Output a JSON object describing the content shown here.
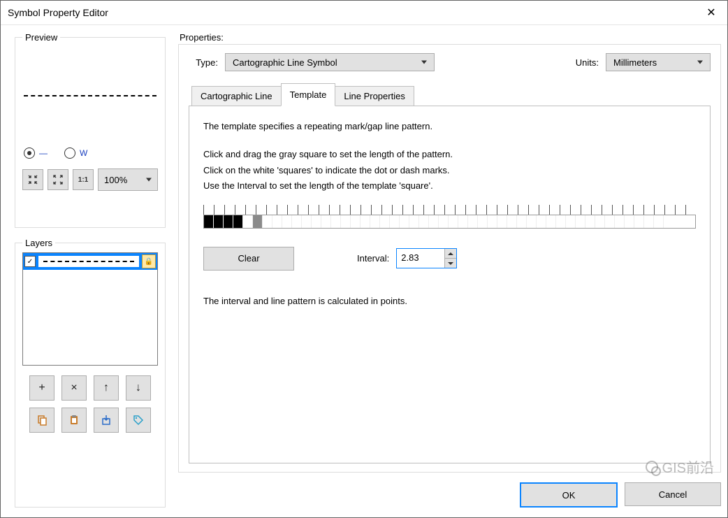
{
  "window": {
    "title": "Symbol Property Editor"
  },
  "preview": {
    "legend": "Preview",
    "zoom": "100%",
    "radios": {
      "line_glyph": "—",
      "zigzag_glyph": "ᐂ"
    }
  },
  "layers": {
    "legend": "Layers",
    "row_checked": "✓"
  },
  "properties": {
    "label": "Properties:",
    "type_label": "Type:",
    "type_value": "Cartographic Line Symbol",
    "units_label": "Units:",
    "units_value": "Millimeters",
    "tabs": {
      "cartographic": "Cartographic Line",
      "template": "Template",
      "lineprops": "Line Properties"
    },
    "template": {
      "line1": "The template specifies a repeating mark/gap line pattern.",
      "line2": "Click and drag the gray square to set the length of the pattern.",
      "line3": "Click on the white 'squares' to indicate the dot or dash marks.",
      "line4": "Use the Interval to set the length of the template 'square'.",
      "clear": "Clear",
      "interval_label": "Interval:",
      "interval_value": "2.83",
      "note": "The interval and line pattern is calculated in points."
    }
  },
  "footer": {
    "ok": "OK",
    "cancel": "Cancel"
  },
  "watermark": "GIS前沿"
}
